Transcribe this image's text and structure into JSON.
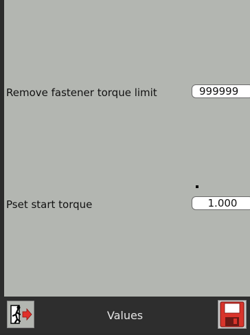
{
  "fields": [
    {
      "label": "Remove fastener torque limit",
      "value": "999999"
    },
    {
      "label": "Pset start torque",
      "value": "1.000"
    }
  ],
  "toolbar": {
    "title": "Values",
    "exit_icon": "exit-icon",
    "save_icon": "save-icon"
  },
  "colors": {
    "background": "#b3b6b1",
    "toolbar": "#2e2e2e",
    "save_red": "#d9342b",
    "exit_red": "#e0302a"
  }
}
